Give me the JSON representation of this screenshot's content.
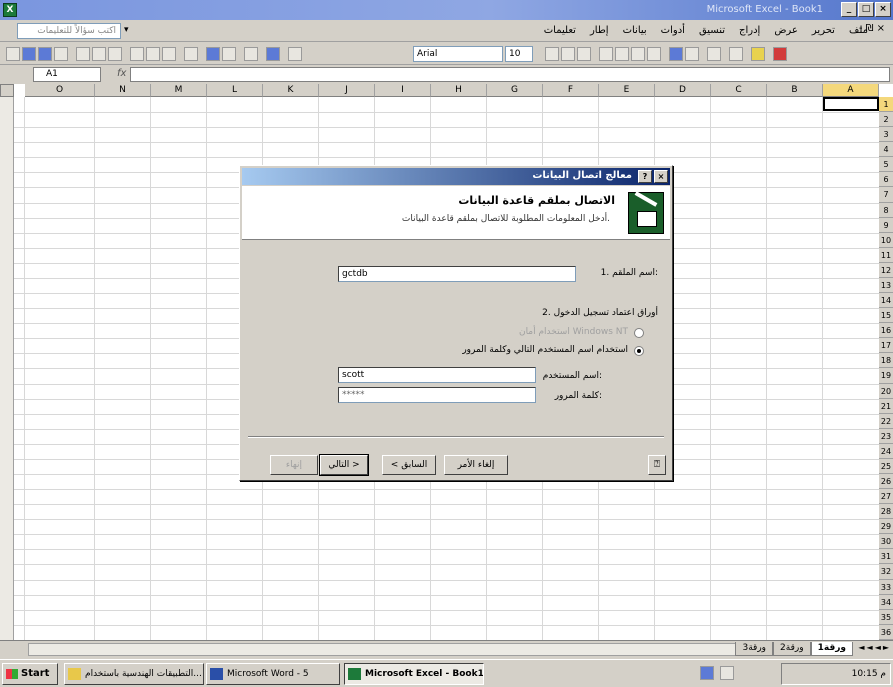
{
  "app": {
    "title": "Microsoft Excel - Book1"
  },
  "menubar": {
    "ask_placeholder": "اكتب سؤالاً للتعليمات",
    "items": [
      "ملف",
      "تحرير",
      "عرض",
      "إدراج",
      "تنسيق",
      "أدوات",
      "بيانات",
      "إطار",
      "تعليمات"
    ],
    "doc_controls": "- ₪ ×"
  },
  "toolbar": {
    "font": "Arial",
    "size": "10"
  },
  "formula": {
    "cell_ref": "A1",
    "fx": "fx",
    "content": ""
  },
  "grid": {
    "columns": [
      "A",
      "B",
      "C",
      "D",
      "E",
      "F",
      "G",
      "H",
      "I",
      "J",
      "K",
      "L",
      "M",
      "N",
      "O"
    ],
    "rows": [
      "1",
      "2",
      "3",
      "4",
      "5",
      "6",
      "7",
      "8",
      "9",
      "10",
      "11",
      "12",
      "13",
      "14",
      "15",
      "16",
      "17",
      "18",
      "19",
      "20",
      "21",
      "22",
      "23",
      "24",
      "25",
      "26",
      "27",
      "28",
      "29",
      "30",
      "31",
      "32",
      "33",
      "34",
      "35",
      "36"
    ],
    "active_cell": "A1"
  },
  "sheets": {
    "tabs": [
      "ورقة1",
      "ورقة2",
      "ورقة3"
    ],
    "active": "ورقة1"
  },
  "dialog": {
    "title": "معالج اتصال البيانات",
    "header_title": "الاتصال بملقم قاعدة البيانات",
    "header_subtitle": "أدخل المعلومات المطلوبة للاتصال بملقم قاعدة البيانات.",
    "server_label": "1. اسم الملقم:",
    "server_value": "gctdb",
    "credentials_label": "2. أوراق اعتماد تسجيل الدخول",
    "option_windows": "استخدام أمان Windows NT",
    "option_sql": "استخدام اسم المستخدم التالي وكلمة المرور",
    "username_label": "اسم المستخدم:",
    "username_value": "scott",
    "password_label": "كلمة المرور:",
    "password_value": "*****",
    "buttons": {
      "cancel": "إلغاء الأمر",
      "back": "< السابق",
      "next": "التالي >",
      "finish": "إنهاء"
    }
  },
  "taskbar": {
    "start": "Start",
    "tasks": [
      "التطبيقات الهندسية باستخدام...",
      "Microsoft Word - 5",
      "Microsoft Excel - Book1"
    ],
    "clock": "10:15 م"
  }
}
